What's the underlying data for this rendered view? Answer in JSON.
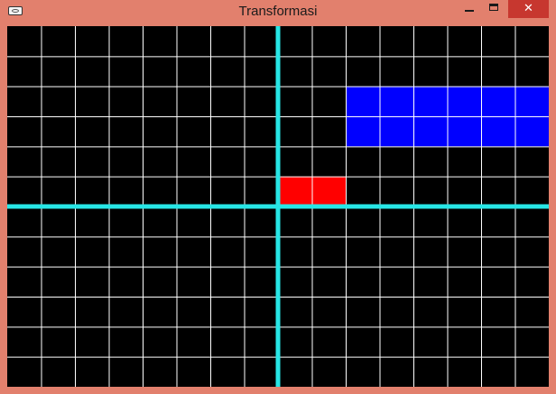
{
  "window": {
    "title": "Transformasi",
    "close_glyph": "✕",
    "icons": {
      "app": "app-window-icon",
      "minimize": "minimize-icon",
      "maximize": "maximize-icon",
      "close": "close-icon"
    }
  },
  "canvas": {
    "background": "#000000",
    "grid_color": "#ffffff",
    "axis_color": "#27e6e6",
    "columns": 16,
    "rows": 12,
    "shapes": [
      {
        "name": "red-rectangle",
        "color": "#ff0000",
        "col_start": 8,
        "row_start": 5,
        "cols": 2,
        "rows": 1
      },
      {
        "name": "blue-rectangle",
        "color": "#0000ff",
        "col_start": 10,
        "row_start": 2,
        "cols": 6,
        "rows": 2
      }
    ]
  }
}
